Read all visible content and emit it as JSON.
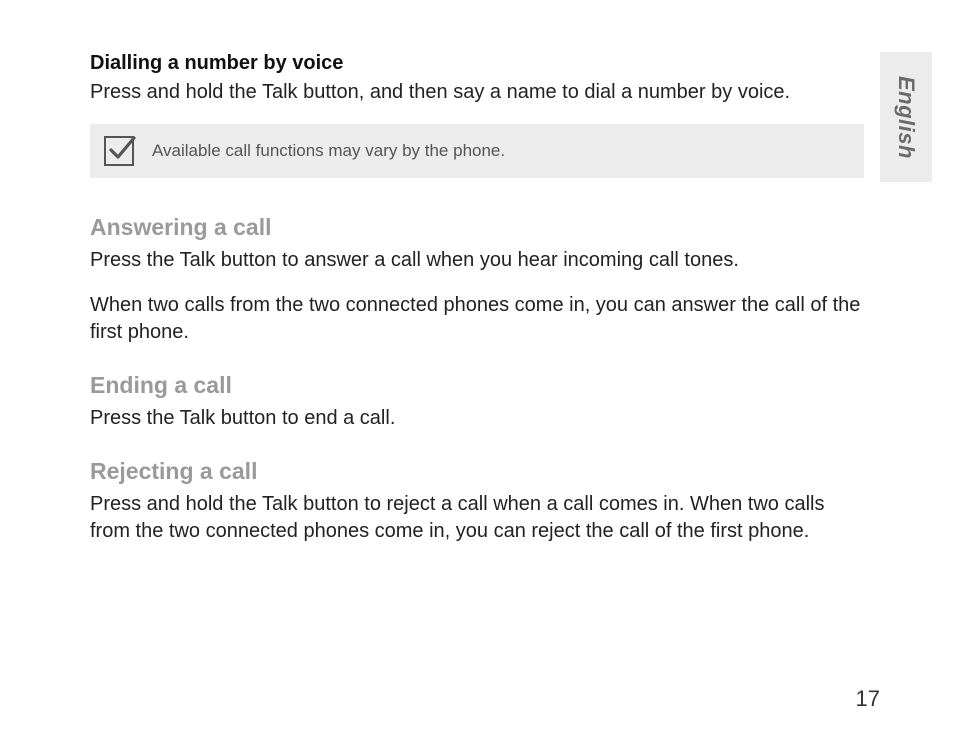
{
  "sideTab": "English",
  "sections": {
    "s0": {
      "heading": "Dialling a number by voice",
      "body": "Press and hold the Talk button, and then say a name to dial a number by voice."
    },
    "note": {
      "text": "Available call functions may vary by the phone."
    },
    "s1": {
      "heading": "Answering a call",
      "body1": "Press the Talk button to answer a call when you hear incoming call tones.",
      "body2": "When two calls from the two connected phones come in, you can answer the call of the first phone."
    },
    "s2": {
      "heading": "Ending a call",
      "body": "Press the Talk button to end a call."
    },
    "s3": {
      "heading": "Rejecting a call",
      "body": "Press and hold the Talk button to reject a call when a call comes in. When two calls from the two connected phones come in, you can reject the call of the first phone."
    }
  },
  "pageNumber": "17"
}
